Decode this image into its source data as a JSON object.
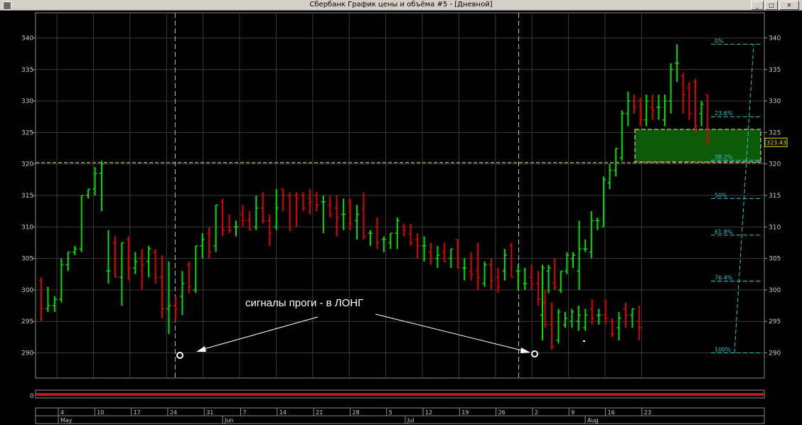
{
  "window": {
    "title": "Сбербанк График цены и объёма #5 - [Дневной]",
    "minimize_label": "_",
    "maximize_label": "□",
    "close_label": "✕"
  },
  "chart_data": {
    "type": "ohlc",
    "ylim": [
      286,
      344
    ],
    "y_ticks": [
      290,
      295,
      300,
      305,
      310,
      315,
      320,
      325,
      330,
      335,
      340
    ],
    "grid": true,
    "current_price_label": "323.43",
    "up_color": "#00e000",
    "down_color": "#e00000",
    "annotation_text": "сигналы проги - в ЛОНГ",
    "x_day_labels": [
      "4",
      "10",
      "17",
      "24",
      "31",
      "7",
      "14",
      "21",
      "28",
      "5",
      "12",
      "19",
      "26",
      "2",
      "9",
      "16",
      "23"
    ],
    "x_month_labels": [
      "May",
      "Jun",
      "Jul",
      "Aug"
    ],
    "signal_bar_indices": [
      23,
      89
    ],
    "horizontal_level": 320.2,
    "zone": {
      "low": 320.3,
      "high": 325.5,
      "color": "#0a5a0a"
    },
    "fib_levels": [
      {
        "label": "0%",
        "value": 339.0
      },
      {
        "label": "23.6%",
        "value": 327.5
      },
      {
        "label": "38.2%",
        "value": 320.6
      },
      {
        "label": "50%",
        "value": 314.5
      },
      {
        "label": "61.8%",
        "value": 308.7
      },
      {
        "label": "76.4%",
        "value": 301.4
      },
      {
        "label": "100%",
        "value": 290.0
      }
    ],
    "ohlc": [
      [
        301.5,
        302,
        295,
        297
      ],
      [
        297,
        300.5,
        296.5,
        297.5
      ],
      [
        297.5,
        299,
        296.5,
        298.5
      ],
      [
        298.5,
        305,
        298,
        304
      ],
      [
        304,
        306,
        303,
        306
      ],
      [
        306,
        307,
        305.5,
        306.5
      ],
      [
        306.5,
        315,
        306,
        315
      ],
      [
        315,
        316,
        314.5,
        316
      ],
      [
        316,
        319.5,
        315,
        318.5
      ],
      [
        318.5,
        320.5,
        312.5,
        320
      ],
      [
        303,
        309.5,
        301,
        303
      ],
      [
        307.5,
        308.5,
        302,
        302
      ],
      [
        302,
        307.5,
        297.5,
        307.5
      ],
      [
        308,
        308.5,
        301.5,
        303.5
      ],
      [
        303.5,
        306,
        302.5,
        304.5
      ],
      [
        305,
        306.5,
        300,
        304
      ],
      [
        304.5,
        307,
        302,
        306.5
      ],
      [
        306,
        306.5,
        301,
        302
      ],
      [
        302,
        305.5,
        295.5,
        297
      ],
      [
        297,
        304.5,
        293,
        297.5
      ],
      [
        297.5,
        299,
        295,
        297
      ],
      [
        299,
        303,
        296,
        301
      ],
      [
        304,
        304.5,
        299.5,
        300.5
      ],
      [
        300,
        307,
        299.5,
        307
      ],
      [
        307,
        309,
        305,
        308
      ],
      [
        309,
        310,
        305,
        306
      ],
      [
        307,
        313.5,
        306,
        313.5
      ],
      [
        314,
        314.5,
        308.5,
        309.5
      ],
      [
        310,
        312,
        309,
        309.5
      ],
      [
        310,
        311,
        308.5,
        310
      ],
      [
        312,
        313.5,
        310,
        311
      ],
      [
        311,
        312.5,
        309.5,
        309.5
      ],
      [
        310,
        315,
        309.5,
        313
      ],
      [
        313,
        315.5,
        310.5,
        311
      ],
      [
        311,
        312,
        307,
        309
      ],
      [
        310,
        316,
        309.5,
        313
      ],
      [
        316,
        316,
        312.5,
        315
      ],
      [
        315,
        315.5,
        309.5,
        309.5
      ],
      [
        315,
        315.5,
        310,
        314.5
      ],
      [
        315,
        315.5,
        312.5,
        313
      ],
      [
        314.5,
        316,
        312,
        314
      ],
      [
        315,
        315.5,
        312.5,
        313.5
      ],
      [
        314,
        315,
        309,
        314
      ],
      [
        313.5,
        315,
        311.5,
        312
      ],
      [
        313,
        315,
        308.5,
        311.5
      ],
      [
        312,
        314.5,
        309.5,
        312
      ],
      [
        314,
        314.5,
        309.5,
        310.5
      ],
      [
        311,
        313.5,
        308,
        312
      ],
      [
        313,
        315.5,
        308,
        308.5
      ],
      [
        309,
        309.5,
        307,
        309
      ],
      [
        310,
        311.5,
        306.5,
        307.5
      ],
      [
        308,
        308.5,
        306,
        308
      ],
      [
        307.5,
        309,
        306.5,
        309
      ],
      [
        309,
        311.5,
        306.5,
        311
      ],
      [
        310,
        310.5,
        308.5,
        309.5
      ],
      [
        309,
        310.5,
        307,
        307.5
      ],
      [
        308,
        309,
        305,
        307
      ],
      [
        307,
        308.5,
        304.5,
        307
      ],
      [
        306,
        307.5,
        304,
        305
      ],
      [
        305,
        307,
        303.5,
        305.5
      ],
      [
        306,
        307.5,
        304.5,
        304.5
      ],
      [
        305,
        306.5,
        303.5,
        306.5
      ],
      [
        308,
        308,
        303.5,
        303.5
      ],
      [
        303.5,
        305,
        301.5,
        303.5
      ],
      [
        303,
        306,
        301.5,
        302.5
      ],
      [
        303,
        307.5,
        300,
        302
      ],
      [
        301,
        304.5,
        300.5,
        304
      ],
      [
        304,
        305,
        300,
        301.5
      ],
      [
        302,
        303.5,
        299.5,
        300.5
      ],
      [
        303,
        306.5,
        301.5,
        305.5
      ],
      [
        307,
        307.5,
        302,
        302
      ],
      [
        303,
        304,
        300,
        303
      ],
      [
        301,
        303.5,
        300,
        301
      ],
      [
        302,
        304,
        300,
        301
      ],
      [
        301,
        303,
        297.5,
        298.5
      ],
      [
        298,
        300,
        294,
        294.5
      ],
      [
        294.5,
        298,
        290.5,
        291
      ],
      [
        292,
        297,
        291.5,
        296.5
      ],
      [
        294.5,
        296.5,
        294,
        295.5
      ],
      [
        295,
        297,
        294,
        296.5
      ],
      [
        295,
        297.5,
        293.5,
        296
      ],
      [
        294,
        297,
        293.5,
        296
      ],
      [
        297,
        298.5,
        294.5,
        295.5
      ],
      [
        296,
        297,
        294.5,
        296
      ],
      [
        296,
        298.5,
        294.5,
        295.5
      ],
      [
        295,
        295.5,
        292.5,
        293
      ],
      [
        294,
        296.5,
        292,
        295.5
      ],
      [
        297,
        298,
        294,
        296
      ],
      [
        296,
        297,
        294,
        297
      ],
      [
        295,
        297.5,
        292,
        294
      ]
    ]
  }
}
